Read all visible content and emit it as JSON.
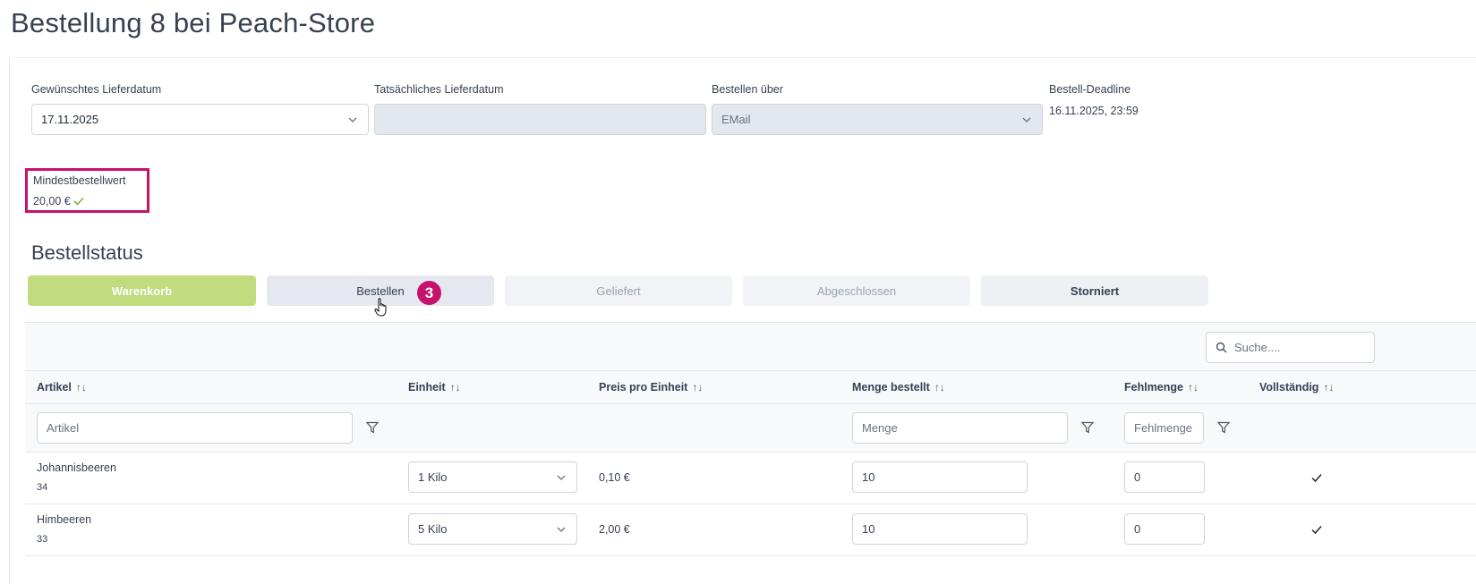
{
  "page": {
    "title": "Bestellung 8 bei Peach-Store"
  },
  "fields": {
    "wish_date": {
      "label": "Gewünschtes Lieferdatum",
      "value": "17.11.2025"
    },
    "actual_date": {
      "label": "Tatsächliches Lieferdatum",
      "value": ""
    },
    "order_via": {
      "label": "Bestellen über",
      "value": "EMail"
    },
    "deadline": {
      "label": "Bestell-Deadline",
      "value": "16.11.2025, 23:59"
    }
  },
  "min_order": {
    "label": "Mindestbestellwert",
    "value": "20,00 €"
  },
  "status": {
    "title": "Bestellstatus",
    "buttons": [
      {
        "label": "Warenkorb"
      },
      {
        "label": "Bestellen"
      },
      {
        "label": "Geliefert"
      },
      {
        "label": "Abgeschlossen"
      },
      {
        "label": "Storniert"
      }
    ],
    "step_badge": "3"
  },
  "table": {
    "search_placeholder": "Suche....",
    "sort_icon": "↑↓",
    "columns": [
      {
        "label": "Artikel"
      },
      {
        "label": "Einheit"
      },
      {
        "label": "Preis pro Einheit"
      },
      {
        "label": "Menge bestellt"
      },
      {
        "label": "Fehlmenge"
      },
      {
        "label": "Vollständig"
      }
    ],
    "filters": {
      "artikel_placeholder": "Artikel",
      "menge_placeholder": "Menge",
      "fehlmenge_placeholder": "Fehlmenge"
    },
    "rows": [
      {
        "name": "Johannisbeeren",
        "id": "34",
        "unit": "1 Kilo",
        "price": "0,10 €",
        "qty": "10",
        "missing": "0"
      },
      {
        "name": "Himbeeren",
        "id": "33",
        "unit": "5 Kilo",
        "price": "2,00 €",
        "qty": "10",
        "missing": "0"
      }
    ]
  },
  "colors": {
    "accent": "#c5126f",
    "active_status": "#c0dc7f",
    "check_green": "#7cb342"
  }
}
